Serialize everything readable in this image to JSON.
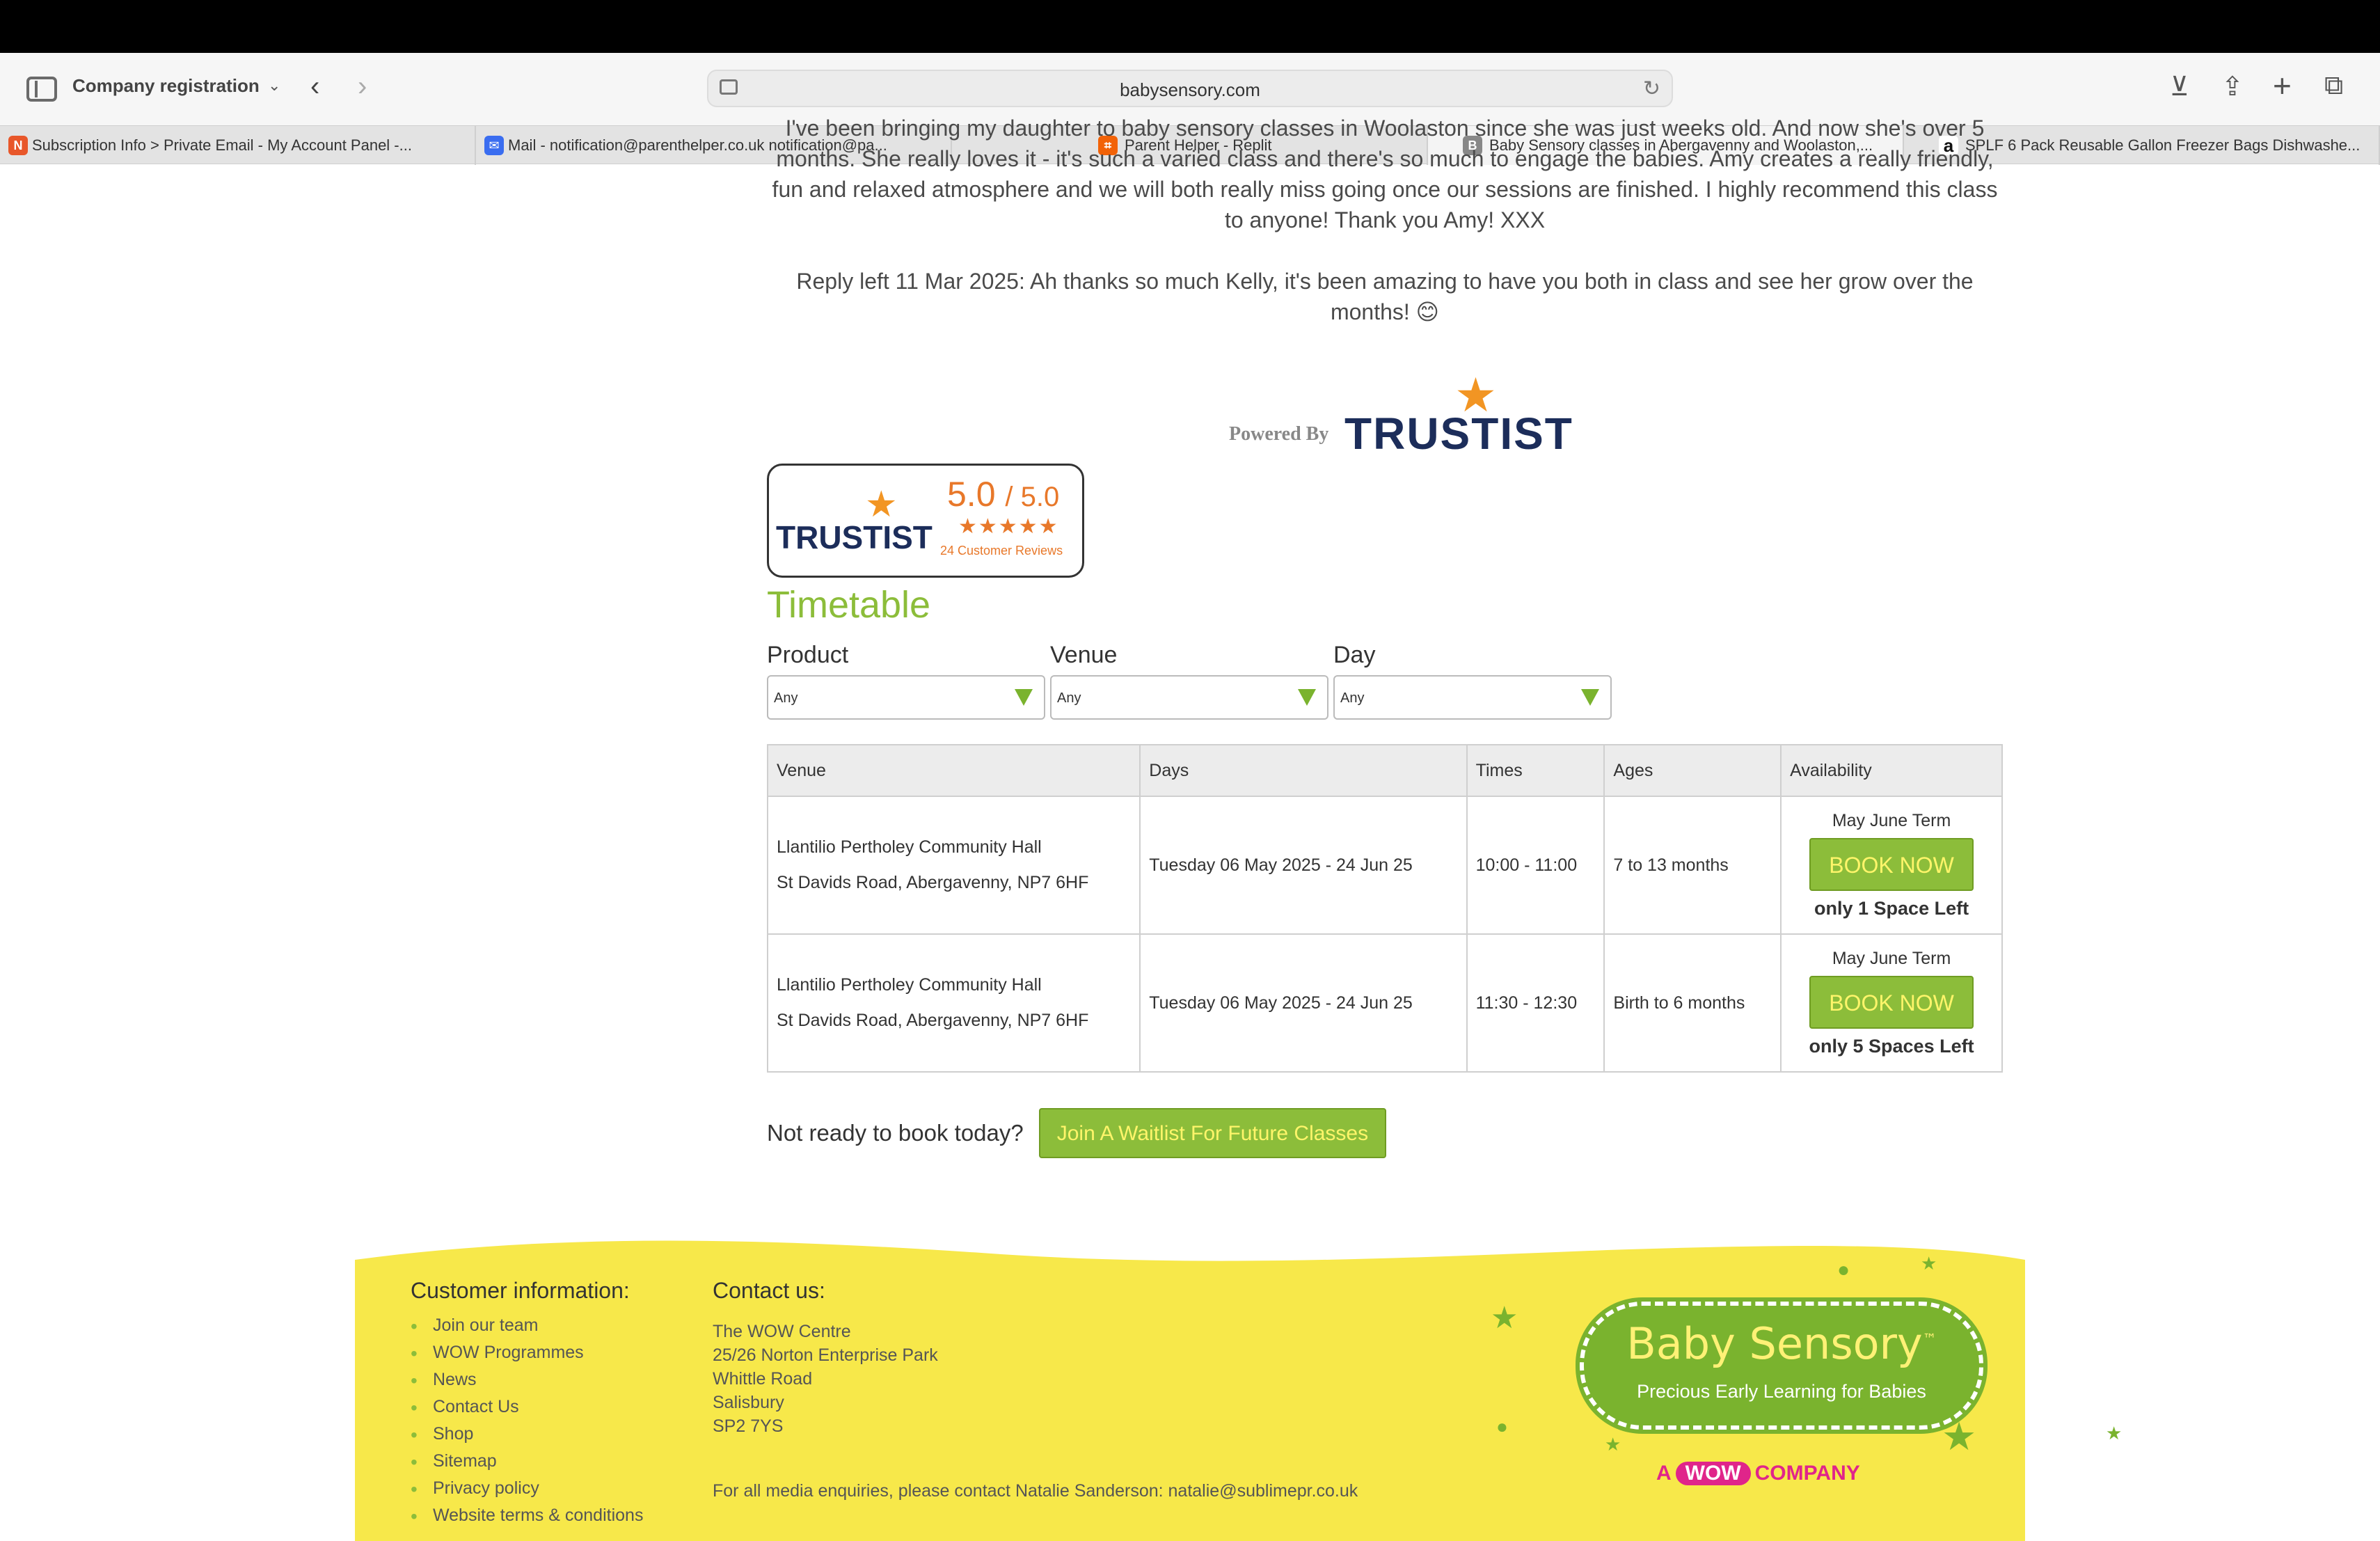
{
  "browser": {
    "window_title": "Company registration",
    "url": "babysensory.com",
    "tabs": [
      {
        "label": "Subscription Info > Private Email - My Account Panel -...",
        "icon": "namecheap-icon",
        "color": "#e8572a"
      },
      {
        "label": "Mail - notification@parenthelper.co.uk notification@pa...",
        "icon": "mail-icon",
        "color": "#3a6df0"
      },
      {
        "label": "Parent Helper - Replit",
        "icon": "replit-icon",
        "color": "#f26207"
      },
      {
        "label": "Baby Sensory classes in Abergavenny and Woolaston,...",
        "icon": "b-icon",
        "color": "#888888"
      },
      {
        "label": "SPLF 6 Pack Reusable Gallon Freezer Bags Dishwashe...",
        "icon": "amazon-icon",
        "color": "#111111"
      }
    ]
  },
  "review": {
    "text": "I've been bringing my daughter to baby sensory classes in Woolaston since she was just weeks old. And now she's over 5 months. She really loves it - it's such a varied class and there's so much to engage the babies. Amy creates a really friendly, fun and relaxed atmosphere and we will both really miss going once our sessions are finished. I highly recommend this class to anyone! Thank you Amy! XXX",
    "reply": "Reply left 11 Mar 2025:  Ah thanks so much Kelly, it's been amazing to have you both in class and see her grow over the months! 😊"
  },
  "powered_by": {
    "label": "Powered By",
    "brand": "TRUSTIST"
  },
  "trust_badge": {
    "brand": "TRUSTIST",
    "score": "5.0",
    "out_of": "/ 5.0",
    "stars": "★★★★★",
    "reviews": "24 Customer Reviews"
  },
  "timetable": {
    "title": "Timetable",
    "filters": [
      {
        "label": "Product",
        "value": "Any"
      },
      {
        "label": "Venue",
        "value": "Any"
      },
      {
        "label": "Day",
        "value": "Any"
      }
    ],
    "columns": [
      "Venue",
      "Days",
      "Times",
      "Ages",
      "Availability"
    ],
    "rows": [
      {
        "venue_name": "Llantilio Pertholey Community Hall",
        "venue_address": "St Davids Road, Abergavenny, NP7 6HF",
        "days": "Tuesday 06 May 2025 - 24 Jun 25",
        "times": "10:00 - 11:00",
        "ages": "7 to 13 months",
        "term": "May June Term",
        "button": "BOOK NOW",
        "spaces": "only 1 Space Left"
      },
      {
        "venue_name": "Llantilio Pertholey Community Hall",
        "venue_address": "St Davids Road, Abergavenny, NP7 6HF",
        "days": "Tuesday 06 May 2025 - 24 Jun 25",
        "times": "11:30 - 12:30",
        "ages": "Birth to 6 months",
        "term": "May June Term",
        "button": "BOOK NOW",
        "spaces": "only 5 Spaces Left"
      }
    ],
    "waitlist_question": "Not ready to book today?",
    "waitlist_button": "Join A Waitlist For Future Classes"
  },
  "footer": {
    "customer_title": "Customer information:",
    "customer_links": [
      "Join our team",
      "WOW Programmes",
      "News",
      "Contact Us",
      "Shop",
      "Sitemap",
      "Privacy policy",
      "Website terms & conditions"
    ],
    "contact_title": "Contact us:",
    "address": [
      "The WOW Centre",
      "25/26 Norton Enterprise Park",
      "Whittle Road",
      "Salisbury",
      "SP2 7YS"
    ],
    "media": "For all media enquiries, please contact Natalie Sanderson: natalie@sublimepr.co.uk",
    "logo_name": "Baby Sensory",
    "logo_tm": "™",
    "logo_tagline": "Precious Early Learning for Babies",
    "wow_prefix": "A",
    "wow_pill": "WOW",
    "wow_suffix": "COMPANY"
  },
  "colors": {
    "accent_green": "#8cbd3a",
    "button_text_yellow": "#fff56a",
    "footer_yellow": "#f7e84a",
    "trustist_navy": "#1c2d5a",
    "trustist_orange": "#e8782a"
  }
}
